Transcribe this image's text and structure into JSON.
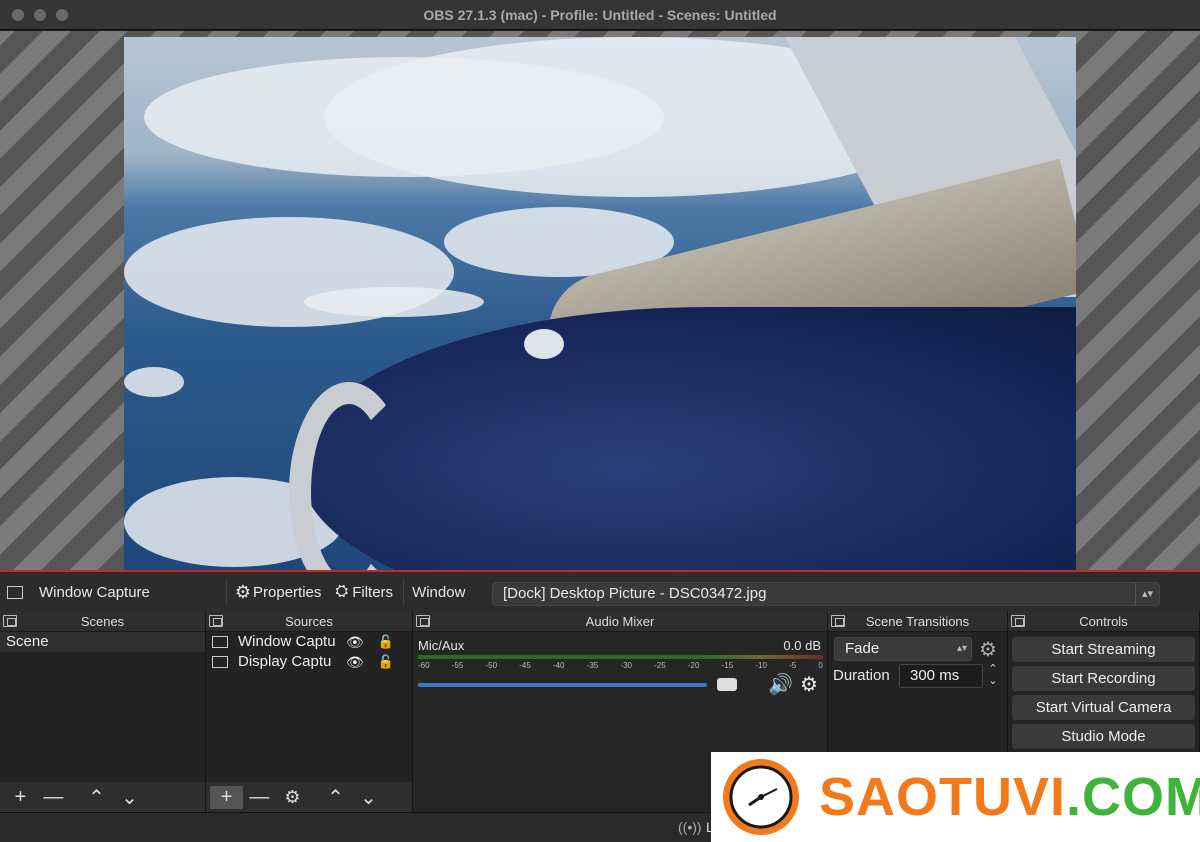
{
  "window": {
    "title": "OBS 27.1.3 (mac) - Profile: Untitled - Scenes: Untitled"
  },
  "source_toolbar": {
    "source_name": "Window Capture",
    "properties_label": "Properties",
    "filters_label": "Filters",
    "window_label": "Window",
    "window_value": "[Dock] Desktop Picture - DSC03472.jpg"
  },
  "scenes": {
    "header": "Scenes",
    "items": [
      "Scene"
    ]
  },
  "sources": {
    "header": "Sources",
    "items": [
      {
        "label": "Window Captu"
      },
      {
        "label": "Display Captu"
      }
    ]
  },
  "audio_mixer": {
    "header": "Audio Mixer",
    "channel_name": "Mic/Aux",
    "level": "0.0 dB",
    "ticks": [
      "-60",
      "-55",
      "-50",
      "-45",
      "-40",
      "-35",
      "-30",
      "-25",
      "-20",
      "-15",
      "-10",
      "-5",
      "0"
    ],
    "volume_fraction": 0.85
  },
  "scene_transitions": {
    "header": "Scene Transitions",
    "transition": "Fade",
    "duration_label": "Duration",
    "duration_value": "300 ms"
  },
  "controls": {
    "header": "Controls",
    "buttons": [
      "Start Streaming",
      "Start Recording",
      "Start Virtual Camera",
      "Studio Mode"
    ]
  },
  "status_bar": {
    "partial_text": "L"
  },
  "watermark": {
    "text_orange": "SAOTUVI",
    "text_green": ".COM"
  },
  "colors": {
    "accent_red": "#c42c2c",
    "slider_blue": "#3a78c8",
    "watermark_orange": "#f27a1a",
    "watermark_green": "#3fb33a"
  }
}
